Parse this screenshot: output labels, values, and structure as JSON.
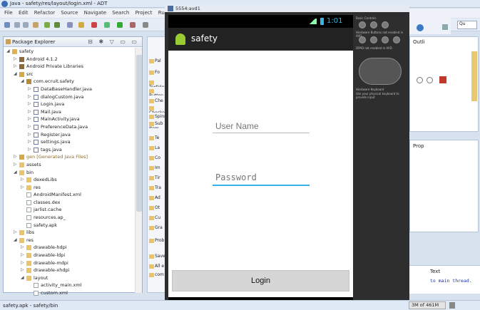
{
  "ide": {
    "title": "Java - safety/res/layout/login.xml - ADT",
    "menu": [
      "File",
      "Edit",
      "Refactor",
      "Source",
      "Navigate",
      "Search",
      "Project",
      "Run",
      "W"
    ],
    "quick_access": "Qu"
  },
  "package_explorer": {
    "title": "Package Explorer",
    "tree": [
      {
        "label": "safety",
        "indent": 0,
        "arrow": "◢",
        "icon": "prj"
      },
      {
        "label": "Android 4.1.2",
        "indent": 1,
        "arrow": "▷",
        "icon": "lib"
      },
      {
        "label": "Android Private Libraries",
        "indent": 1,
        "arrow": "▷",
        "icon": "lib"
      },
      {
        "label": "src",
        "indent": 1,
        "arrow": "◢",
        "icon": "src"
      },
      {
        "label": "com.ecruit.safety",
        "indent": 2,
        "arrow": "◢",
        "icon": "pkgi"
      },
      {
        "label": "DataBaseHandler.java",
        "indent": 3,
        "arrow": "▷",
        "icon": "java"
      },
      {
        "label": "dialogCustom.java",
        "indent": 3,
        "arrow": "▷",
        "icon": "java"
      },
      {
        "label": "Login.java",
        "indent": 3,
        "arrow": "▷",
        "icon": "java"
      },
      {
        "label": "Mail.java",
        "indent": 3,
        "arrow": "▷",
        "icon": "java"
      },
      {
        "label": "MainActivity.java",
        "indent": 3,
        "arrow": "▷",
        "icon": "java"
      },
      {
        "label": "PreferenceData.java",
        "indent": 3,
        "arrow": "▷",
        "icon": "java"
      },
      {
        "label": "Register.java",
        "indent": 3,
        "arrow": "▷",
        "icon": "java"
      },
      {
        "label": "settings.java",
        "indent": 3,
        "arrow": "▷",
        "icon": "java"
      },
      {
        "label": "tags.java",
        "indent": 3,
        "arrow": "▷",
        "icon": "java"
      },
      {
        "label": "gen [Generated Java Files]",
        "indent": 1,
        "arrow": "▷",
        "icon": "src"
      },
      {
        "label": "assets",
        "indent": 1,
        "arrow": "▷",
        "icon": "fold"
      },
      {
        "label": "bin",
        "indent": 1,
        "arrow": "◢",
        "icon": "fold"
      },
      {
        "label": "dexedLibs",
        "indent": 2,
        "arrow": "▷",
        "icon": "fold"
      },
      {
        "label": "res",
        "indent": 2,
        "arrow": "▷",
        "icon": "fold"
      },
      {
        "label": "AndroidManifest.xml",
        "indent": 2,
        "arrow": "",
        "icon": "file"
      },
      {
        "label": "classes.dex",
        "indent": 2,
        "arrow": "",
        "icon": "file"
      },
      {
        "label": "jarlist.cache",
        "indent": 2,
        "arrow": "",
        "icon": "file"
      },
      {
        "label": "resources.ap_",
        "indent": 2,
        "arrow": "",
        "icon": "file"
      },
      {
        "label": "safety.apk",
        "indent": 2,
        "arrow": "",
        "icon": "file"
      },
      {
        "label": "libs",
        "indent": 1,
        "arrow": "▷",
        "icon": "fold"
      },
      {
        "label": "res",
        "indent": 1,
        "arrow": "◢",
        "icon": "fold"
      },
      {
        "label": "drawable-hdpi",
        "indent": 2,
        "arrow": "▷",
        "icon": "fold"
      },
      {
        "label": "drawable-ldpi",
        "indent": 2,
        "arrow": "▷",
        "icon": "fold"
      },
      {
        "label": "drawable-mdpi",
        "indent": 2,
        "arrow": "▷",
        "icon": "fold"
      },
      {
        "label": "drawable-xhdpi",
        "indent": 2,
        "arrow": "▷",
        "icon": "fold"
      },
      {
        "label": "layout",
        "indent": 2,
        "arrow": "◢",
        "icon": "fold"
      },
      {
        "label": "activity_main.xml",
        "indent": 3,
        "arrow": "",
        "icon": "file"
      },
      {
        "label": "custom.xml",
        "indent": 3,
        "arrow": "",
        "icon": "file"
      }
    ]
  },
  "palette": {
    "items": [
      "Pal",
      "Fo",
      "TextView",
      "Button",
      "Che",
      "Checked",
      "Spinn",
      "Sub Item",
      "Te",
      "La",
      "Co",
      "Im",
      "Tir",
      "Tra",
      "Ad",
      "Ot",
      "Cu",
      "Gra",
      "Prob",
      "Saved",
      "All e",
      "com"
    ]
  },
  "emulator": {
    "title": "5554:avd1",
    "clock": "1:01",
    "app_title": "safety",
    "username_placeholder": "User Name",
    "password_placeholder": "Password",
    "login_label": "Login",
    "controls_label_1": "Basic Controls",
    "controls_label_2": "Hardware Buttons not enabled in AVD",
    "controls_label_3": "DPAD not enabled in AVD",
    "controls_label_4": "Hardware Keyboard",
    "controls_label_5": "Use your physical keyboard to provide input"
  },
  "console": {
    "header": "Text",
    "message": "to main thread.",
    "col": "e."
  },
  "outline": {
    "title": "Outli"
  },
  "properties": {
    "title": "Prop"
  },
  "status": {
    "selection": "safety.apk - safety/bin",
    "memory": "3M of 461M"
  }
}
